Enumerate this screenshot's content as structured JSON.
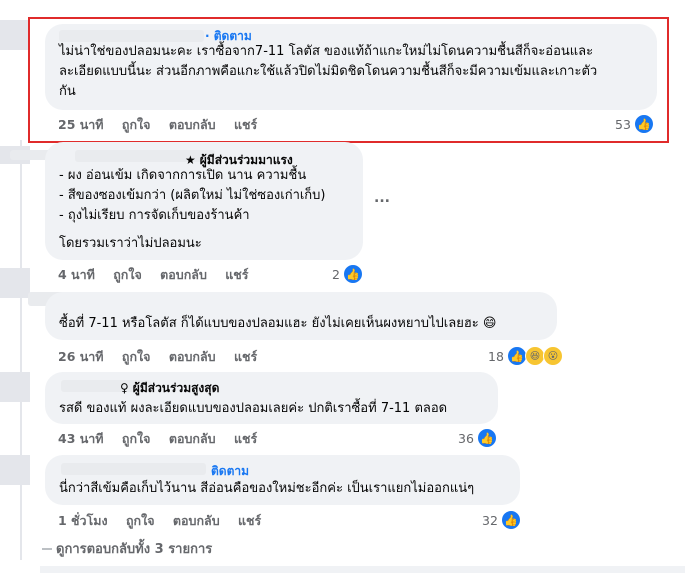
{
  "comments": [
    {
      "follow": "· ติดตาม",
      "text_lines": [
        "ไม่น่าใช่ของปลอมนะคะ เราซื้อจาก7-11 โลตัส ของแท้ถ้าแกะใหม่ไม่โดนความชื้นสีก็จะอ่อนและ",
        "ละเอียดแบบนี้นะ ส่วนอีกภาพคือแกะใช้แล้วปิดไม่มิดชิดโดนความชื้นสีก็จะมีความเข้มและเกาะตัว",
        "กัน"
      ],
      "time": "25 นาที",
      "like_label": "ถูกใจ",
      "reply_label": "ตอบกลับ",
      "share_label": "แชร์",
      "reaction_count": "53"
    },
    {
      "badge_icon": "star-icon",
      "badge": "ผู้มีส่วนร่วมมาแรง",
      "text_lines": [
        "- ผง อ่อนเข้ม เกิดจากการเปิด นาน ความชื้น",
        "- สีของซองเข้มกว่า (ผลิตใหม่ ไม่ใช่ซองเก่าเก็บ)",
        "- ถุงไม่เรียบ การจัดเก็บของร้านค้า",
        "",
        "โดยรวมเราว่าไม่ปลอมนะ"
      ],
      "more": "...",
      "time": "4 นาที",
      "like_label": "ถูกใจ",
      "reply_label": "ตอบกลับ",
      "share_label": "แชร์",
      "reaction_count": "2"
    },
    {
      "text_lines": [
        "ซื้อที่ 7-11 หรือโลตัส ก็ได้แบบของปลอมแฮะ ยังไม่เคยเห็นผงหยาบไปเลยฮะ 😄"
      ],
      "time": "26 นาที",
      "like_label": "ถูกใจ",
      "reply_label": "ตอบกลับ",
      "share_label": "แชร์",
      "reaction_count": "18"
    },
    {
      "badge_icon": "medal-icon",
      "badge": "ผู้มีส่วนร่วมสูงสุด",
      "text_lines": [
        "รสดี ของแท้ ผงละเอียดแบบของปลอมเลยค่ะ ปกติเราซื้อที่ 7-11 ตลอด"
      ],
      "time": "43 นาที",
      "like_label": "ถูกใจ",
      "reply_label": "ตอบกลับ",
      "share_label": "แชร์",
      "reaction_count": "36"
    },
    {
      "follow": "ติดตาม",
      "text_lines": [
        "นี่กว่าสีเข้มคือเก็บไว้นาน สีอ่อนคือของใหม่ชะอีกค่ะ เป็นเราแยกไม่ออกแน่ๆ"
      ],
      "time": "1 ชั่วโมง",
      "like_label": "ถูกใจ",
      "reply_label": "ตอบกลับ",
      "share_label": "แชร์",
      "reaction_count": "32"
    }
  ],
  "view_all_replies": "ดูการตอบกลับทั้ง 3 รายการ",
  "colors": {
    "link": "#1877f2",
    "highlight": "#e02b2b",
    "bubble": "#f0f2f5"
  }
}
